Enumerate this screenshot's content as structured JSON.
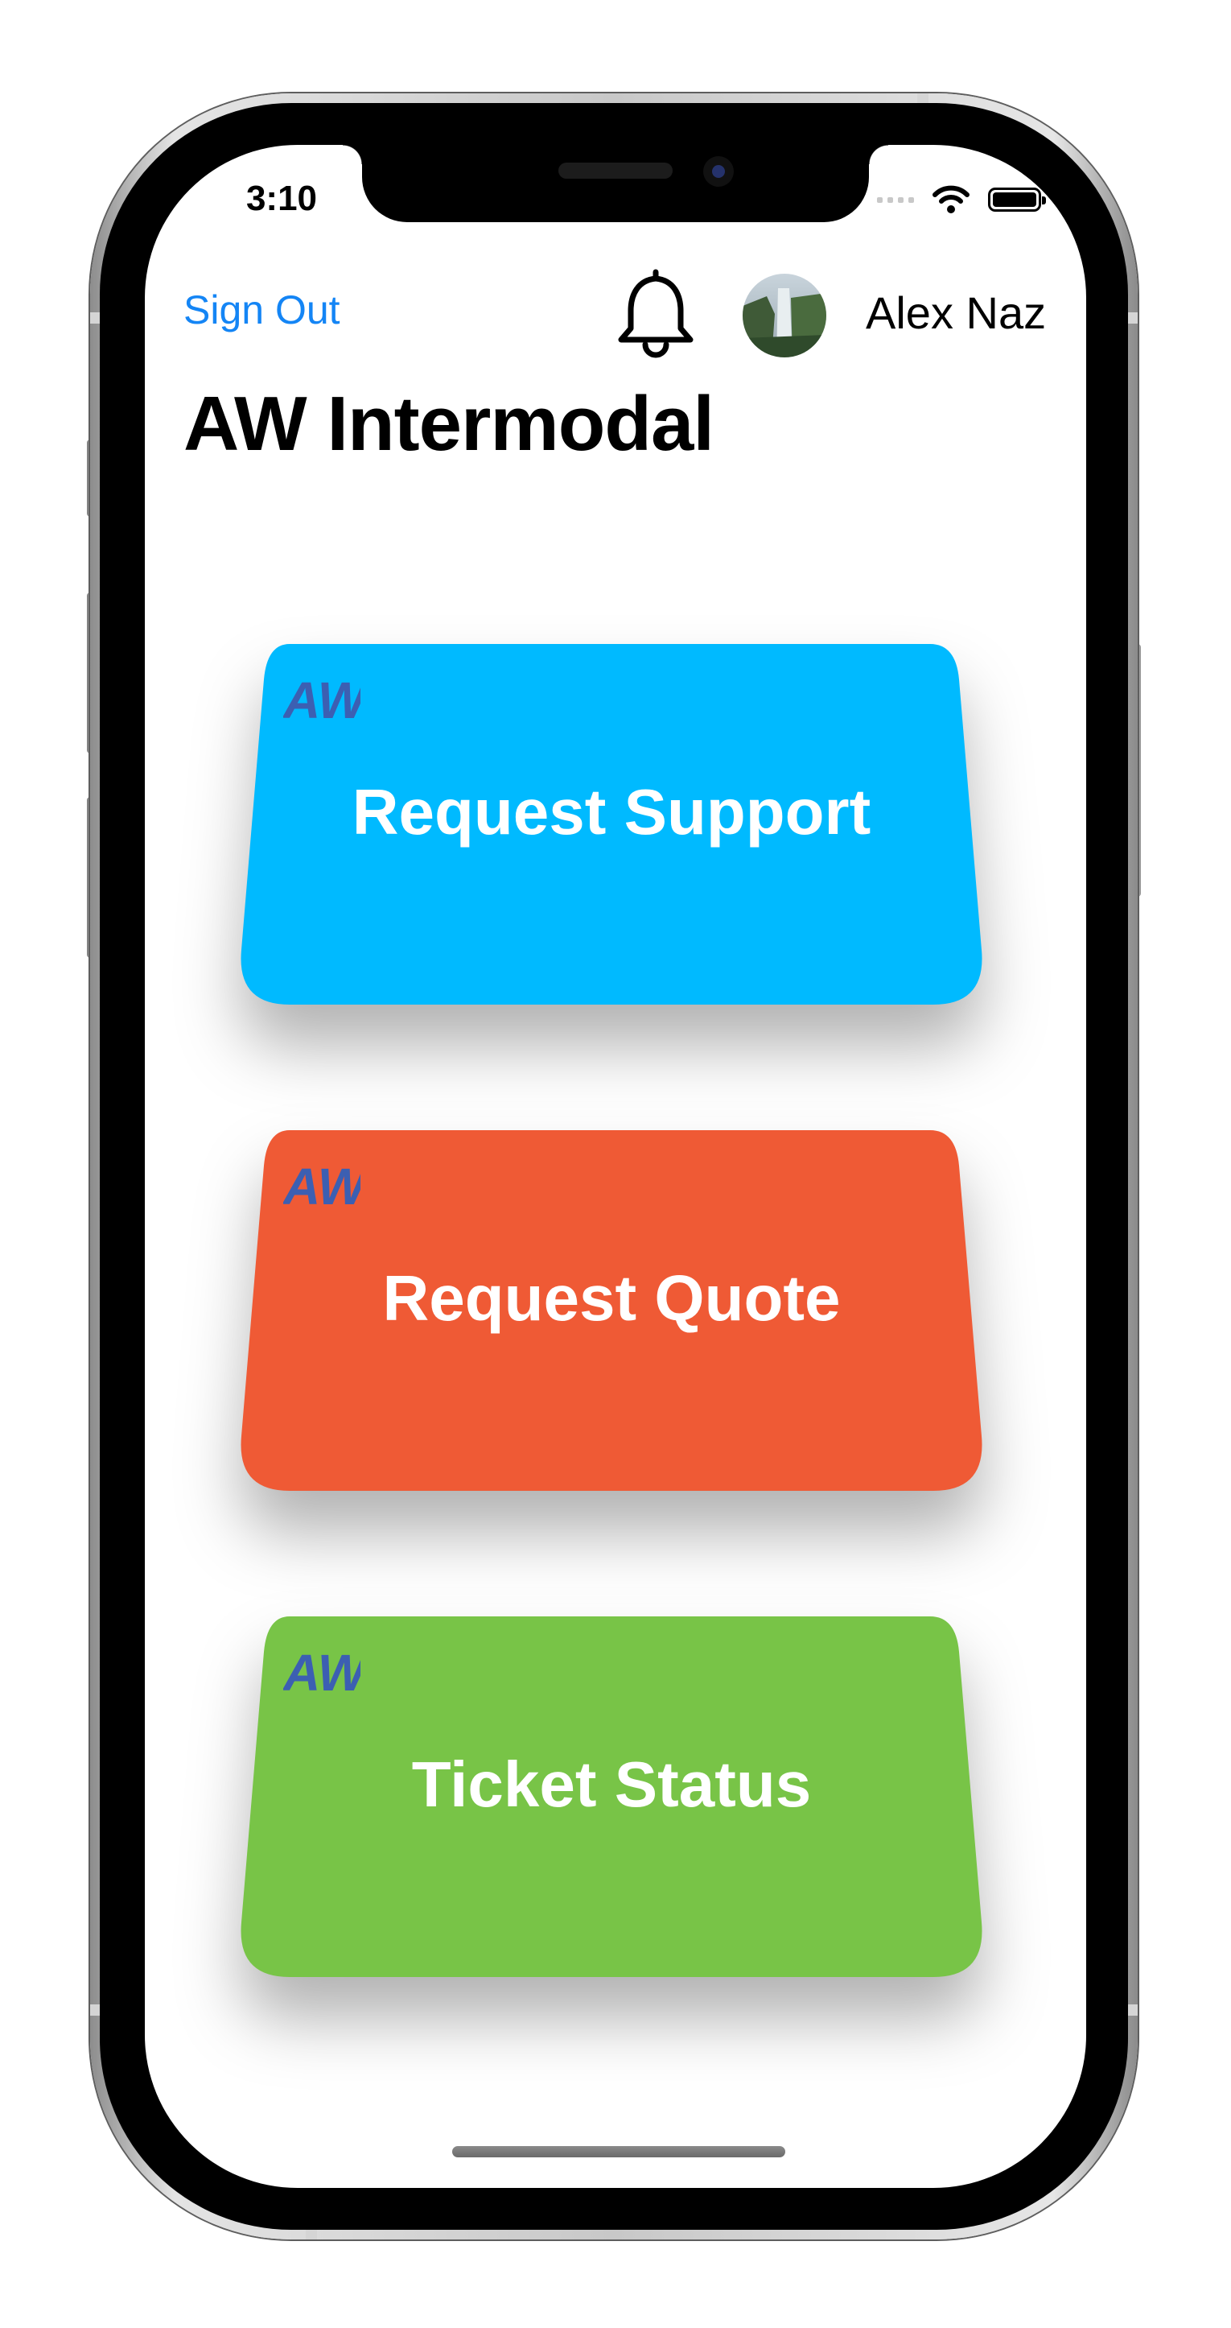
{
  "status_bar": {
    "time": "3:10",
    "icons": [
      "cellular-signal-icon",
      "wifi-icon",
      "battery-icon"
    ]
  },
  "header": {
    "sign_out_label": "Sign Out",
    "notification_icon": "bell-icon",
    "user_avatar": "waterfall-avatar",
    "user_name": "Alex Naz"
  },
  "title": "AW Intermodal",
  "cards": [
    {
      "logo": "AW",
      "label": "Request Support",
      "color": "#00baff"
    },
    {
      "logo": "AW",
      "label": "Request Quote",
      "color": "#ef5a35"
    },
    {
      "logo": "AW",
      "label": "Ticket Status",
      "color": "#78c447"
    }
  ],
  "colors": {
    "link": "#1485f5",
    "logo": "#3c5fb2",
    "card_text": "#ffffff"
  }
}
